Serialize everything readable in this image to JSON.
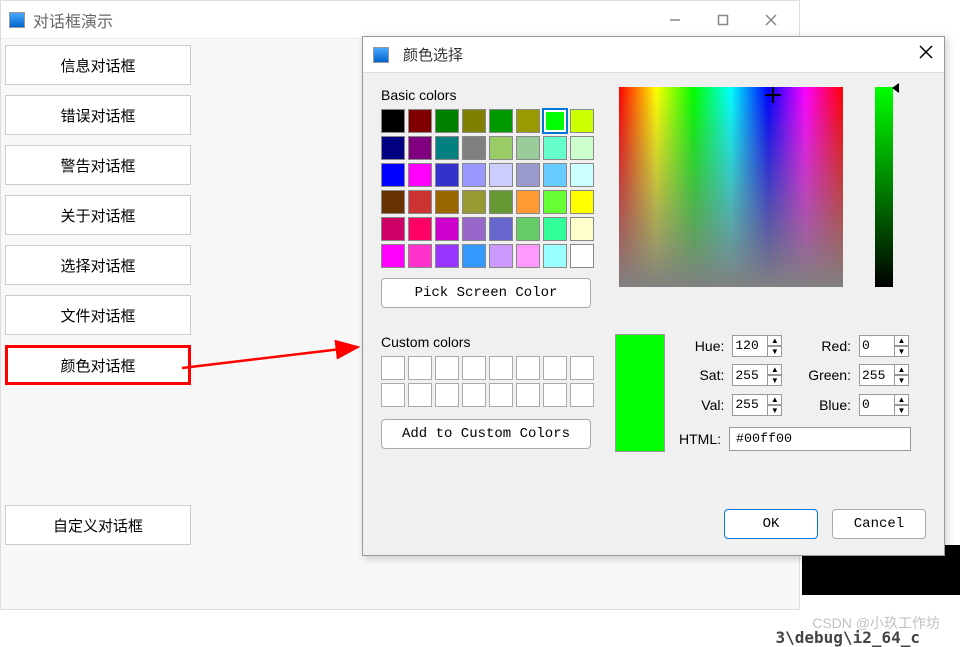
{
  "main_window": {
    "title": "对话框演示"
  },
  "sidebar": {
    "buttons": [
      "信息对话框",
      "错误对话框",
      "警告对话框",
      "关于对话框",
      "选择对话框",
      "文件对话框",
      "颜色对话框",
      "自定义对话框"
    ],
    "selected_index": 6
  },
  "color_dialog": {
    "title": "颜色选择",
    "basic_label": "Basic colors",
    "pick_screen_label": "Pick Screen Color",
    "custom_label": "Custom colors",
    "add_custom_label": "Add to Custom Colors",
    "labels": {
      "hue": "Hue:",
      "sat": "Sat:",
      "val": "Val:",
      "red": "Red:",
      "green": "Green:",
      "blue": "Blue:",
      "html": "HTML:"
    },
    "values": {
      "hue": "120",
      "sat": "255",
      "val": "255",
      "red": "0",
      "green": "255",
      "blue": "0",
      "html": "#00ff00"
    },
    "ok_label": "OK",
    "cancel_label": "Cancel",
    "basic_colors": [
      "#000000",
      "#800000",
      "#008000",
      "#808000",
      "#009900",
      "#999900",
      "#00ff00",
      "#ccff00",
      "#000080",
      "#800080",
      "#008080",
      "#808080",
      "#99cc66",
      "#99cc99",
      "#66ffcc",
      "#ccffcc",
      "#0000ff",
      "#ff00ff",
      "#3333cc",
      "#9999ff",
      "#ccccff",
      "#9999cc",
      "#66ccff",
      "#ccffff",
      "#663300",
      "#cc3333",
      "#996600",
      "#999933",
      "#669933",
      "#ff9933",
      "#66ff33",
      "#ffff00",
      "#cc0066",
      "#ff0066",
      "#cc00cc",
      "#9966cc",
      "#6666cc",
      "#66cc66",
      "#33ff99",
      "#ffffcc",
      "#ff00ff",
      "#ff33cc",
      "#9933ff",
      "#3399ff",
      "#cc99ff",
      "#ff99ff",
      "#99ffff",
      "#ffffff"
    ],
    "selected_swatch_index": 6,
    "custom_colors_count": 16
  },
  "watermark": "CSDN @小玖工作坊",
  "debug_path": "3\\debug\\i2_64_c"
}
